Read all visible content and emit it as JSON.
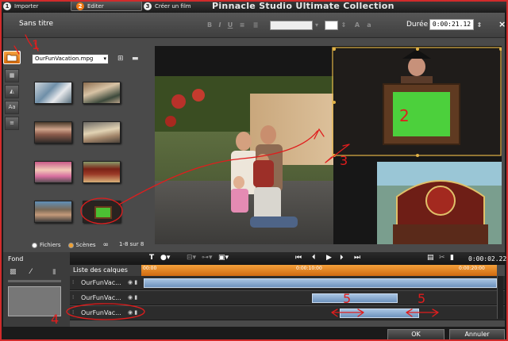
{
  "app": {
    "title": "Pinnacle Studio Ultimate Collection"
  },
  "tabs": [
    {
      "num": "1",
      "label": "Importer"
    },
    {
      "num": "2",
      "label": "Editer"
    },
    {
      "num": "3",
      "label": "Créer un film"
    }
  ],
  "toolbar": {
    "doc_title": "Sans titre",
    "duree_label": "Durée :",
    "duree_value": "0:00:21.12",
    "close": "×",
    "format_buttons": [
      "B",
      "I",
      "U"
    ]
  },
  "left_tools": [
    "folder-icon",
    "video-icon",
    "shapes-icon",
    "Aa",
    "subtitle-icon"
  ],
  "library": {
    "selected_file": "OurFunVacation.mpg",
    "view_options": [
      "Fichiers",
      "Scènes"
    ],
    "selected_view": "Scènes",
    "count": "1-8 sur 8"
  },
  "fond": {
    "label": "Fond"
  },
  "timeline": {
    "time": "0:00:02.22",
    "layers_title": "Liste des calques",
    "ruler": [
      "00:00",
      "0:00:10:00",
      "0:00:20:00"
    ],
    "tracks": [
      {
        "label": "OurFunVac..."
      },
      {
        "label": "OurFunVac..."
      },
      {
        "label": "OurFunVac..."
      }
    ]
  },
  "buttons": {
    "ok": "OK",
    "cancel": "Annuler"
  },
  "annotations": [
    "1",
    "2",
    "3",
    "4",
    "5",
    "5"
  ],
  "colors": {
    "accent": "#f07a16",
    "annotation": "#e01d1d",
    "clip": "#87a9cf",
    "panel": "#4a4a4a"
  }
}
